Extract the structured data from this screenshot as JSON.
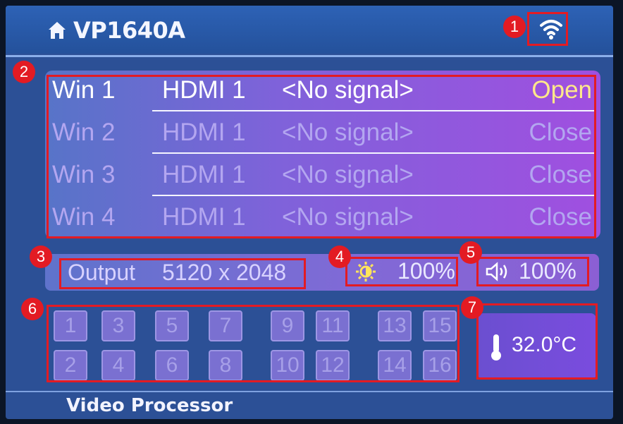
{
  "header": {
    "title": "VP1640A",
    "home_icon": "home-icon",
    "wifi_icon": "wifi-icon"
  },
  "windows": [
    {
      "name": "Win 1",
      "source": "HDMI 1",
      "signal": "<No signal>",
      "state": "Open",
      "active": true
    },
    {
      "name": "Win 2",
      "source": "HDMI 1",
      "signal": "<No signal>",
      "state": "Close",
      "active": false
    },
    {
      "name": "Win 3",
      "source": "HDMI 1",
      "signal": "<No signal>",
      "state": "Close",
      "active": false
    },
    {
      "name": "Win 4",
      "source": "HDMI 1",
      "signal": "<No signal>",
      "state": "Close",
      "active": false
    }
  ],
  "output": {
    "label": "Output",
    "value": "5120 x 2048"
  },
  "brightness": {
    "icon": "brightness-icon",
    "value": "100%"
  },
  "volume": {
    "icon": "speaker-icon",
    "value": "100%"
  },
  "inputs": [
    "1",
    "2",
    "3",
    "4",
    "5",
    "6",
    "7",
    "8",
    "9",
    "10",
    "11",
    "12",
    "13",
    "14",
    "15",
    "16"
  ],
  "temperature": {
    "icon": "thermometer-icon",
    "value": "32.0°C"
  },
  "footer": {
    "label": "Video Processor"
  },
  "annotations": [
    "1",
    "2",
    "3",
    "4",
    "5",
    "6",
    "7"
  ],
  "colors": {
    "annotation": "#e31b23",
    "open_state": "#ffe88a",
    "inactive_text": "#b3a6f0"
  }
}
